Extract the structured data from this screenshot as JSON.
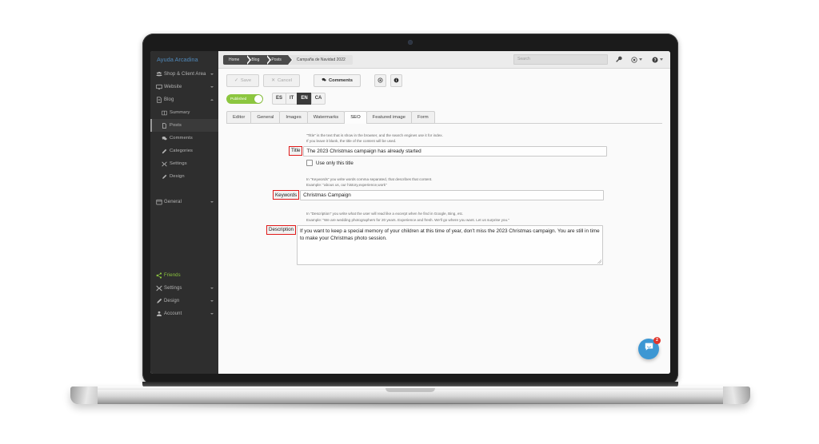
{
  "sidebar": {
    "brand": "Ayuda Arcadina",
    "items": [
      {
        "label": "Shop & Client Area",
        "icon": "users-icon",
        "caret": "down"
      },
      {
        "label": "Website",
        "icon": "monitor-icon",
        "caret": "down"
      },
      {
        "label": "Blog",
        "icon": "file-icon",
        "caret": "up"
      },
      {
        "label": "Summary",
        "icon": "columns-icon",
        "sub": true
      },
      {
        "label": "Posts",
        "icon": "post-icon",
        "sub": true,
        "active": true
      },
      {
        "label": "Comments",
        "icon": "comments-icon",
        "sub": true
      },
      {
        "label": "Categories",
        "icon": "pencil-icon",
        "sub": true
      },
      {
        "label": "Settings",
        "icon": "wrench-icon",
        "sub": true
      },
      {
        "label": "Design",
        "icon": "brush-icon",
        "sub": true
      },
      {
        "label": "General",
        "icon": "calendar-icon",
        "caret": "down"
      },
      {
        "label": "Friends",
        "icon": "share-icon",
        "accent": true
      },
      {
        "label": "Settings",
        "icon": "wrench-icon",
        "caret": "down"
      },
      {
        "label": "Design",
        "icon": "brush-icon",
        "caret": "down"
      },
      {
        "label": "Account",
        "icon": "user-icon",
        "caret": "down"
      }
    ]
  },
  "topbar": {
    "breadcrumbs": [
      "Home",
      "Blog",
      "Posts"
    ],
    "current": "Campaña de Navidad 2022",
    "search_placeholder": "Search",
    "wrench_icon": "wrench-icon",
    "eye_icon": "eye-icon",
    "help_icon": "help-icon"
  },
  "toolbar": {
    "save_label": "Save",
    "cancel_label": "Cancel",
    "comments_label": "Comments",
    "preview_icon": "eye-icon",
    "info_icon": "info-icon"
  },
  "status": {
    "published_label": "Published",
    "languages": [
      "ES",
      "IT",
      "EN",
      "CA"
    ],
    "selected_language": "EN"
  },
  "tabs": {
    "items": [
      "Editor",
      "General",
      "Images",
      "Watermarks",
      "SEO",
      "Featured image",
      "Form"
    ],
    "selected": "SEO"
  },
  "form": {
    "title": {
      "hint_line1": "\"Title\" is the text that is show in the browser, and the search engines use it for index.",
      "hint_line2": "If you leave it blank, the title of the content will be used.",
      "label": "Title",
      "value": "The 2023 Christmas campaign has already started",
      "checkbox_label": "Use only this title",
      "checkbox_checked": false
    },
    "keywords": {
      "hint_line1": "In \"Keywords\" you write words comma separated, that describes that content.",
      "hint_line2": "Example: \"abous us, our history,experience,work\"",
      "label": "Keywords",
      "value": "Christmas Campaign"
    },
    "description": {
      "hint_line1": "In \"Description\" you write what the user will read like a excerpt when he find in Google, Bing, etc.",
      "hint_line2": "Example: \"We are wedding photographers for 20 years. Experience and fresh. We'll go where you want. Let us surprise you.\"",
      "label": "Description",
      "value": "If you want to keep a special memory of your children at this time of year, don't miss the 2023 Christmas campaign. You are still in time to make your Christmas photo session."
    }
  },
  "chat": {
    "icon": "chat-bubble-icon",
    "badge": "2"
  },
  "colors": {
    "accent_green": "#8cc63f",
    "brand_blue": "#4f87b8",
    "annotation_red": "#e01b1b",
    "chat_blue": "#3d97d3",
    "badge_red": "#e0342b",
    "sidebar_bg": "#2e2e2e"
  }
}
